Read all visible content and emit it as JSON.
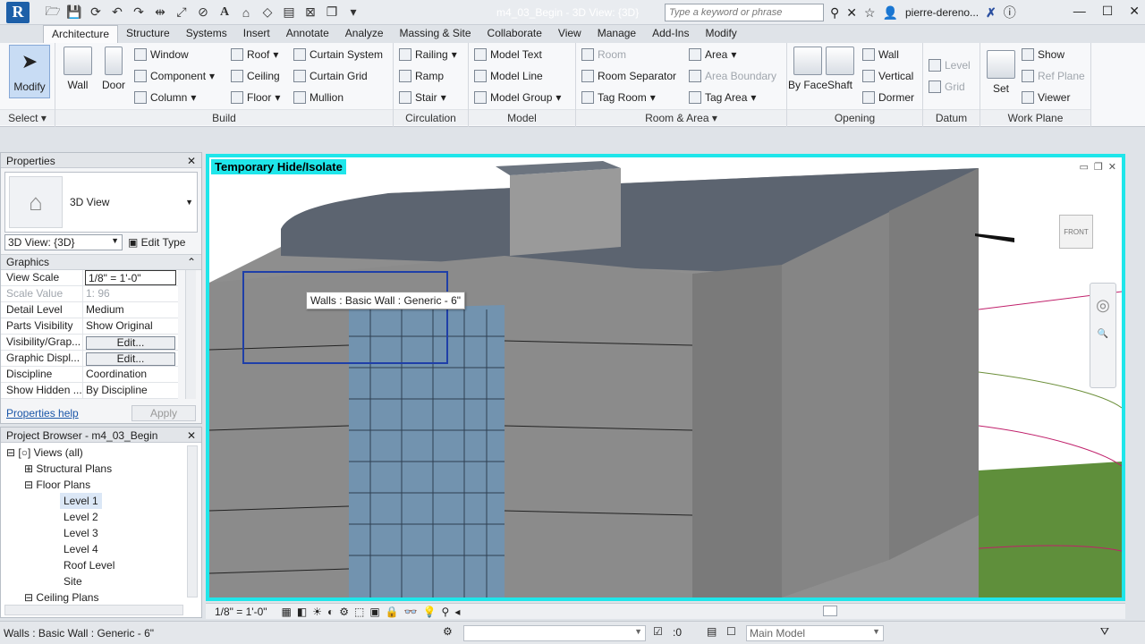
{
  "titlebar": {
    "app_letter": "R",
    "document_title": "m4_03_Begin - 3D View: {3D}",
    "search_placeholder": "Type a keyword or phrase",
    "user": "pierre-dereno..."
  },
  "tabs": [
    "Architecture",
    "Structure",
    "Systems",
    "Insert",
    "Annotate",
    "Analyze",
    "Massing & Site",
    "Collaborate",
    "View",
    "Manage",
    "Add-Ins",
    "Modify"
  ],
  "ribbon": {
    "select": {
      "modify": "Modify",
      "label": "Select"
    },
    "build": {
      "label": "Build",
      "wall": "Wall",
      "door": "Door",
      "window": "Window",
      "component": "Component",
      "column": "Column",
      "roof": "Roof",
      "ceiling": "Ceiling",
      "floor": "Floor",
      "curtain_system": "Curtain System",
      "curtain_grid": "Curtain Grid",
      "mullion": "Mullion"
    },
    "circulation": {
      "label": "Circulation",
      "railing": "Railing",
      "ramp": "Ramp",
      "stair": "Stair"
    },
    "model": {
      "label": "Model",
      "model_text": "Model Text",
      "model_line": "Model Line",
      "model_group": "Model Group"
    },
    "room_area": {
      "label": "Room & Area",
      "room": "Room",
      "room_separator": "Room Separator",
      "tag_room": "Tag Room",
      "area": "Area",
      "area_boundary": "Area Boundary",
      "tag_area": "Tag Area"
    },
    "opening": {
      "label": "Opening",
      "by_face": "By Face",
      "shaft": "Shaft",
      "wall": "Wall",
      "vertical": "Vertical",
      "dormer": "Dormer"
    },
    "datum": {
      "label": "Datum",
      "level": "Level",
      "grid": "Grid"
    },
    "work_plane": {
      "label": "Work Plane",
      "set": "Set",
      "show": "Show",
      "ref_plane": "Ref Plane",
      "viewer": "Viewer"
    }
  },
  "properties": {
    "title": "Properties",
    "type_name": "3D View",
    "filter_value": "3D View: {3D}",
    "edit_type": "Edit Type",
    "section": "Graphics",
    "rows": [
      {
        "k": "View Scale",
        "v": "1/8\" = 1'-0\""
      },
      {
        "k": "Scale Value",
        "v": "96"
      },
      {
        "k": "Detail Level",
        "v": "Medium"
      },
      {
        "k": "Parts Visibility",
        "v": "Show Original"
      },
      {
        "k": "Visibility/Grap...",
        "v": "Edit..."
      },
      {
        "k": "Graphic Displ...",
        "v": "Edit..."
      },
      {
        "k": "Discipline",
        "v": "Coordination"
      },
      {
        "k": "Show Hidden ...",
        "v": "By Discipline"
      }
    ],
    "scale_value_prefix": "1:",
    "help": "Properties help",
    "apply": "Apply"
  },
  "browser": {
    "title": "Project Browser - m4_03_Begin",
    "views_all": "Views (all)",
    "structural_plans": "Structural Plans",
    "floor_plans": "Floor Plans",
    "levels": [
      "Level 1",
      "Level 2",
      "Level 3",
      "Level 4",
      "Roof Level",
      "Site"
    ],
    "ceiling_plans": "Ceiling Plans"
  },
  "viewport": {
    "hide_label": "Temporary Hide/Isolate",
    "tooltip": "Walls : Basic Wall : Generic - 6\"",
    "cube_face": "FRONT",
    "scale": "1/8\" = 1'-0\""
  },
  "statusbar": {
    "message": "Walls : Basic Wall : Generic - 6\"",
    "selection_count": ":0",
    "workset": "Main Model"
  }
}
